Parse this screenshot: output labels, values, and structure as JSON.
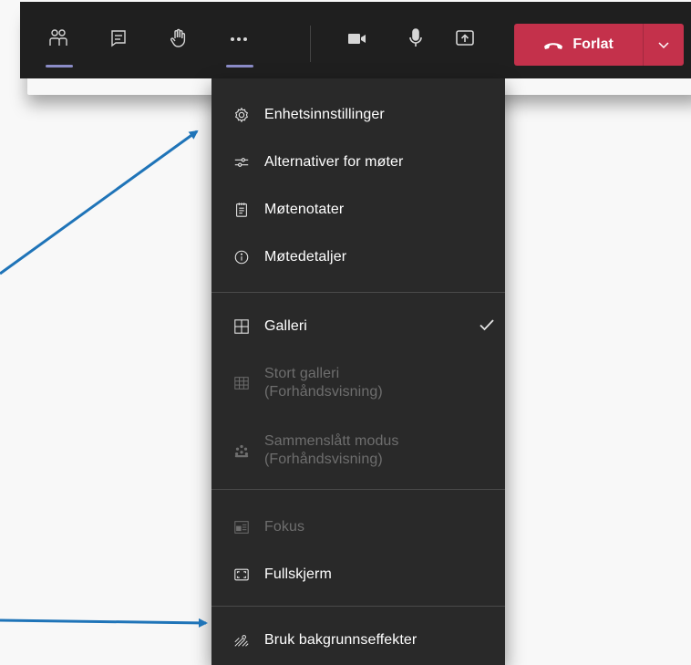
{
  "toolbar": {
    "buttons": [
      {
        "icon": "people-icon",
        "name": "participants"
      },
      {
        "icon": "chat-icon",
        "name": "chat"
      },
      {
        "icon": "raise-hand-icon",
        "name": "raise-hand"
      },
      {
        "icon": "more-icon",
        "name": "more-actions"
      },
      {
        "icon": "video-camera-icon",
        "name": "camera"
      },
      {
        "icon": "microphone-icon",
        "name": "microphone"
      },
      {
        "icon": "share-screen-icon",
        "name": "share"
      }
    ],
    "leave_label": "Forlat",
    "leave_color": "#c4314b",
    "accent": "#8b8cc7"
  },
  "menu": {
    "items": [
      {
        "label": "Enhetsinnstillinger",
        "icon": "gear-icon"
      },
      {
        "label": "Alternativer for møter",
        "icon": "sliders-icon"
      },
      {
        "label": "Møtenotater",
        "icon": "notes-icon"
      },
      {
        "label": "Møtedetaljer",
        "icon": "info-icon"
      },
      {
        "label": "Galleri",
        "icon": "gallery-grid-icon",
        "checked": true
      },
      {
        "label_line1": "Stort galleri",
        "label_line2": "(Forhåndsvisning)",
        "icon": "large-gallery-icon",
        "disabled": true
      },
      {
        "label_line1": "Sammenslått modus",
        "label_line2": "(Forhåndsvisning)",
        "icon": "together-mode-icon",
        "disabled": true
      },
      {
        "label": "Fokus",
        "icon": "focus-icon",
        "disabled": true
      },
      {
        "label": "Fullskjerm",
        "icon": "fullscreen-icon"
      },
      {
        "label": "Bruk bakgrunnseffekter",
        "icon": "background-effects-icon"
      }
    ]
  },
  "annotation_color": "#1f74b8"
}
